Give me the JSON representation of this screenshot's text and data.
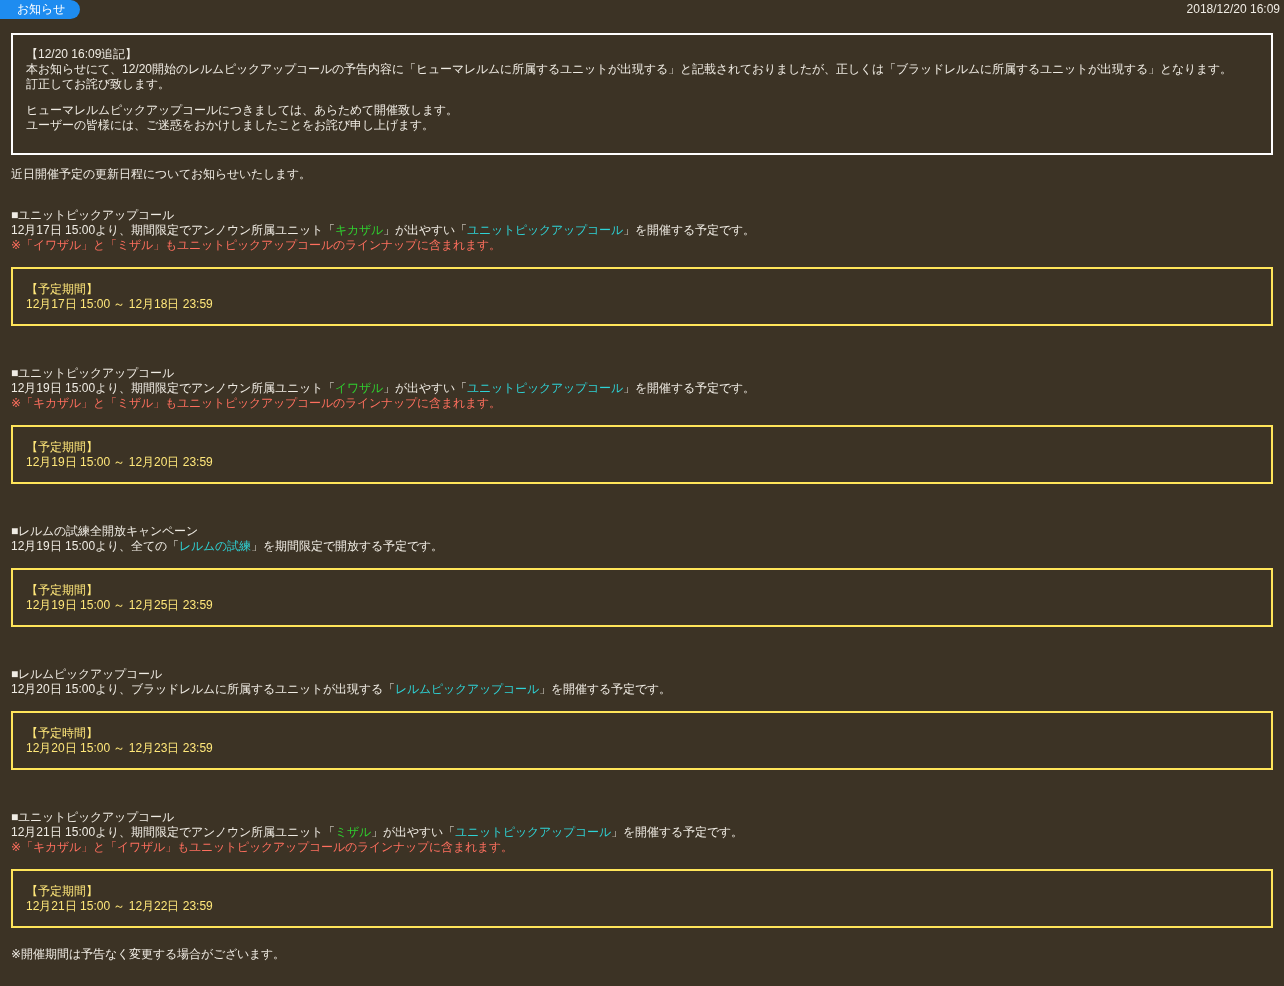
{
  "header": {
    "badge": "お知らせ",
    "date": "2018/12/20 16:09"
  },
  "notice": {
    "paragraphs": [
      [
        "【12/20 16:09追記】",
        "本お知らせにて、12/20開始のレルムピックアップコールの予告内容に「ヒューマレルムに所属するユニットが出現する」と記載されておりましたが、正しくは「ブラッドレルムに所属するユニットが出現する」となります。",
        "訂正してお詫び致します。"
      ],
      [
        "ヒューマレルムピックアップコールにつきましては、あらためて開催致します。",
        "ユーザーの皆様には、ご迷惑をおかけしましたことをお詫び申し上げます。"
      ]
    ]
  },
  "intro": "近日開催予定の更新日程についてお知らせいたします。",
  "sections": [
    {
      "title": "■ユニットピックアップコール",
      "description": [
        {
          "kind": "plain",
          "text": "12月17日 15:00より、期間限定でアンノウン所属ユニット「"
        },
        {
          "kind": "unit",
          "text": "キカザル"
        },
        {
          "kind": "plain",
          "text": "」が出やすい「"
        },
        {
          "kind": "event",
          "text": "ユニットピックアップコール"
        },
        {
          "kind": "plain",
          "text": "」を開催する予定です。"
        }
      ],
      "note": "※「イワザル」と「ミザル」もユニットピックアップコールのラインナップに含まれます。",
      "period": {
        "label": "【予定期間】",
        "range": "12月17日 15:00 ～ 12月18日 23:59"
      }
    },
    {
      "title": "■ユニットピックアップコール",
      "description": [
        {
          "kind": "plain",
          "text": "12月19日 15:00より、期間限定でアンノウン所属ユニット「"
        },
        {
          "kind": "unit",
          "text": "イワザル"
        },
        {
          "kind": "plain",
          "text": "」が出やすい「"
        },
        {
          "kind": "event",
          "text": "ユニットピックアップコール"
        },
        {
          "kind": "plain",
          "text": "」を開催する予定です。"
        }
      ],
      "note": "※「キカザル」と「ミザル」もユニットピックアップコールのラインナップに含まれます。",
      "period": {
        "label": "【予定期間】",
        "range": "12月19日 15:00 ～ 12月20日 23:59"
      }
    },
    {
      "title": "■レルムの試練全開放キャンペーン",
      "description": [
        {
          "kind": "plain",
          "text": "12月19日 15:00より、全ての「"
        },
        {
          "kind": "event",
          "text": "レルムの試練"
        },
        {
          "kind": "plain",
          "text": "」を期間限定で開放する予定です。"
        }
      ],
      "period": {
        "label": "【予定期間】",
        "range": "12月19日 15:00 ～ 12月25日 23:59"
      }
    },
    {
      "title": "■レルムピックアップコール",
      "description": [
        {
          "kind": "plain",
          "text": "12月20日 15:00より、ブラッドレルムに所属するユニットが出現する「"
        },
        {
          "kind": "event",
          "text": "レルムピックアップコール"
        },
        {
          "kind": "plain",
          "text": "」を開催する予定です。"
        }
      ],
      "period": {
        "label": "【予定時間】",
        "range": "12月20日 15:00 ～ 12月23日 23:59"
      }
    },
    {
      "title": "■ユニットピックアップコール",
      "description": [
        {
          "kind": "plain",
          "text": "12月21日 15:00より、期間限定でアンノウン所属ユニット「"
        },
        {
          "kind": "unit",
          "text": "ミザル"
        },
        {
          "kind": "plain",
          "text": "」が出やすい「"
        },
        {
          "kind": "event",
          "text": "ユニットピックアップコール"
        },
        {
          "kind": "plain",
          "text": "」を開催する予定です。"
        }
      ],
      "note": "※「キカザル」と「イワザル」もユニットピックアップコールのラインナップに含まれます。",
      "period": {
        "label": "【予定期間】",
        "range": "12月21日 15:00 ～ 12月22日 23:59"
      }
    }
  ],
  "footer": "※開催期間は予告なく変更する場合がございます。"
}
